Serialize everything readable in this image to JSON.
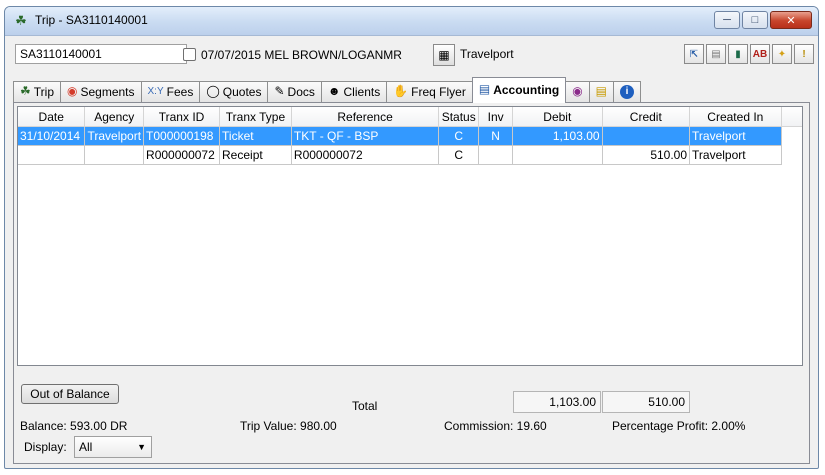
{
  "window": {
    "title": "Trip - SA3110140001"
  },
  "toolbar": {
    "trip_number": "SA3110140001",
    "trip_description": "07/07/2015 MEL BROWN/LOGANMR",
    "gds_label": "Travelport",
    "tool_icons": [
      "export-icon",
      "document-icon",
      "book-icon",
      "ab-icon",
      "pin-icon",
      "warning-icon"
    ]
  },
  "tabs": [
    {
      "label": "Trip",
      "icon": "palm-tree-icon"
    },
    {
      "label": "Segments",
      "icon": "segments-icon"
    },
    {
      "label": "Fees",
      "icon": "fees-icon"
    },
    {
      "label": "Quotes",
      "icon": "speech-bubble-icon"
    },
    {
      "label": "Docs",
      "icon": "docs-icon"
    },
    {
      "label": "Clients",
      "icon": "clients-icon"
    },
    {
      "label": "Freq Flyer",
      "icon": "hand-icon"
    },
    {
      "label": "Accounting",
      "icon": "ledger-icon",
      "active": true
    },
    {
      "label": "",
      "icon": "eye-icon"
    },
    {
      "label": "",
      "icon": "notes-icon"
    },
    {
      "label": "",
      "icon": "info-icon"
    }
  ],
  "table": {
    "columns": [
      "Date",
      "Agency",
      "Tranx ID",
      "Tranx Type",
      "Reference",
      "Status",
      "Inv",
      "Debit",
      "Credit",
      "Created In"
    ],
    "rows": [
      {
        "date": "31/10/2014",
        "agency": "Travelport",
        "tranx_id": "T000000198",
        "tranx_type": "Ticket",
        "reference": "TKT - QF - BSP",
        "status": "C",
        "inv": "N",
        "debit": "1,103.00",
        "credit": "",
        "created_in": "Travelport",
        "selected": true
      },
      {
        "date": "",
        "agency": "",
        "tranx_id": "R000000072",
        "tranx_type": "Receipt",
        "reference": "R000000072",
        "status": "C",
        "inv": "",
        "debit": "",
        "credit": "510.00",
        "created_in": "Travelport",
        "selected": false
      }
    ]
  },
  "totals": {
    "label": "Total",
    "debit": "1,103.00",
    "credit": "510.00"
  },
  "buttons": {
    "out_of_balance": "Out of Balance"
  },
  "summary": {
    "balance": "Balance: 593.00 DR",
    "trip_value": "Trip Value: 980.00",
    "commission": "Commission: 19.60",
    "percentage_profit": "Percentage Profit: 2.00%"
  },
  "display": {
    "label": "Display:",
    "value": "All"
  },
  "colors": {
    "selection": "#3399ff",
    "accent": "#c7452b"
  }
}
